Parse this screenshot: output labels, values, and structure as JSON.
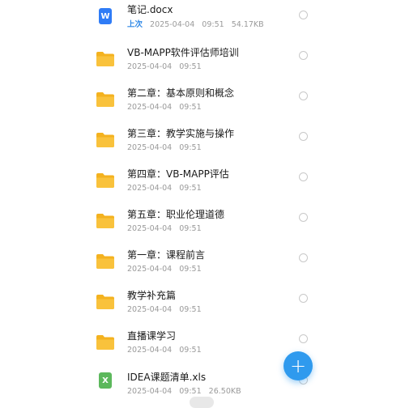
{
  "files": [
    {
      "type": "docx",
      "name": "笔记.docx",
      "badge": "上次",
      "date": "2025-04-04",
      "time": "09:51",
      "size": "54.17KB",
      "icon": "word-doc-icon",
      "color": "#2f7cf6"
    },
    {
      "type": "folder",
      "name": "VB-MAPP软件评估师培训",
      "date": "2025-04-04",
      "time": "09:51",
      "icon": "folder-icon"
    },
    {
      "type": "folder",
      "name": "第二章：基本原则和概念",
      "date": "2025-04-04",
      "time": "09:51",
      "icon": "folder-icon"
    },
    {
      "type": "folder",
      "name": "第三章：教学实施与操作",
      "date": "2025-04-04",
      "time": "09:51",
      "icon": "folder-icon"
    },
    {
      "type": "folder",
      "name": "第四章：VB-MAPP评估",
      "date": "2025-04-04",
      "time": "09:51",
      "icon": "folder-icon"
    },
    {
      "type": "folder",
      "name": "第五章：职业伦理道德",
      "date": "2025-04-04",
      "time": "09:51",
      "icon": "folder-icon"
    },
    {
      "type": "folder",
      "name": "第一章：课程前言",
      "date": "2025-04-04",
      "time": "09:51",
      "icon": "folder-icon"
    },
    {
      "type": "folder",
      "name": "教学补充篇",
      "date": "2025-04-04",
      "time": "09:51",
      "icon": "folder-icon"
    },
    {
      "type": "folder",
      "name": "直播课学习",
      "date": "2025-04-04",
      "time": "09:51",
      "icon": "folder-icon"
    },
    {
      "type": "xls",
      "name": "IDEA课题清单.xls",
      "date": "2025-04-04",
      "time": "09:51",
      "size": "26.50KB",
      "icon": "excel-icon",
      "color": "#5cb85c"
    }
  ],
  "fab": {
    "label": "+",
    "icon": "plus-icon"
  },
  "colors": {
    "folder": "#f9c23c",
    "folder_back": "#f4b21f",
    "accent": "#2f9aee"
  }
}
